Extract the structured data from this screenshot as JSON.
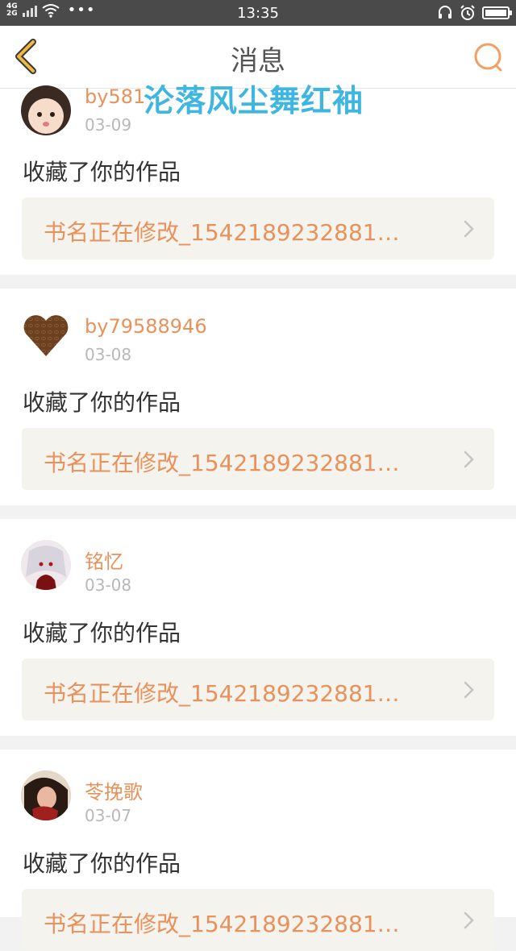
{
  "status_bar": {
    "network_top": "4G",
    "network_bottom": "2G",
    "time": "13:35"
  },
  "header": {
    "title": "消息",
    "back_icon": "chevron-left-icon",
    "search_icon": "search-icon"
  },
  "watermark": "沦落风尘舞红袖",
  "messages": [
    {
      "username": "by581",
      "date": "03-09",
      "action": "收藏了你的作品",
      "book": "书名正在修改_1542189232881…"
    },
    {
      "username": "by79588946",
      "date": "03-08",
      "action": "收藏了你的作品",
      "book": "书名正在修改_1542189232881…"
    },
    {
      "username": "铭忆",
      "date": "03-08",
      "action": "收藏了你的作品",
      "book": "书名正在修改_1542189232881…"
    },
    {
      "username": "苓挽歌",
      "date": "03-07",
      "action": "收藏了你的作品",
      "book": "书名正在修改_1542189232881…"
    }
  ],
  "colors": {
    "accent": "#e8915a",
    "header_icon": "#f0b840",
    "watermark": "#3fb6e0"
  }
}
